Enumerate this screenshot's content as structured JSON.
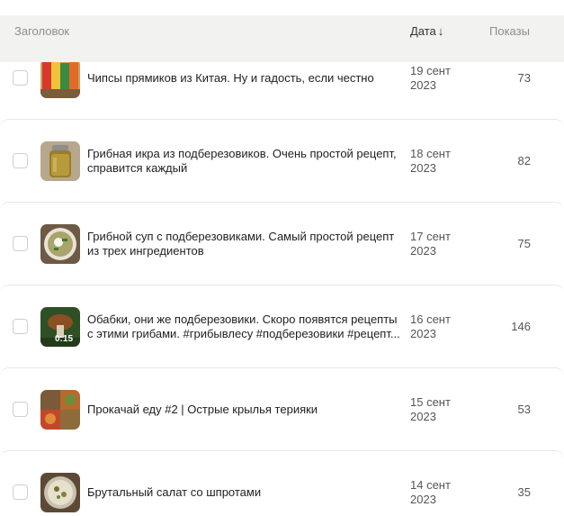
{
  "header": {
    "title_col": "Заголовок",
    "date_col": "Дата",
    "date_sort_icon": "arrow-down-icon",
    "views_col": "Показы"
  },
  "rows": [
    {
      "title": "Чипсы прямиков из Китая. Ну и гадость, если честно",
      "date_day": "19 сент",
      "date_year": "2023",
      "views": "73",
      "thumb": "chips-thumbnail"
    },
    {
      "title": "Грибная икра из подберезовиков. Очень простой рецепт, справится каждый",
      "date_day": "18 сент",
      "date_year": "2023",
      "views": "82",
      "thumb": "jar-thumbnail"
    },
    {
      "title": "Грибной суп с подберезовиками. Самый простой рецепт из трех ингредиентов",
      "date_day": "17 сент",
      "date_year": "2023",
      "views": "75",
      "thumb": "soup-thumbnail"
    },
    {
      "title": "Обабки, они же подберезовики. Скоро появятся рецепты с этими грибами. #грибывлесу #подберезовики #рецепт...",
      "date_day": "16 сент",
      "date_year": "2023",
      "views": "146",
      "thumb": "mushroom-thumbnail",
      "duration": "0:15"
    },
    {
      "title": "Прокачай еду #2 | Острые крылья терияки",
      "date_day": "15 сент",
      "date_year": "2023",
      "views": "53",
      "thumb": "wings-thumbnail"
    },
    {
      "title": "Брутальный салат со шпротами",
      "date_day": "14 сент",
      "date_year": "2023",
      "views": "35",
      "thumb": "salad-thumbnail"
    }
  ]
}
